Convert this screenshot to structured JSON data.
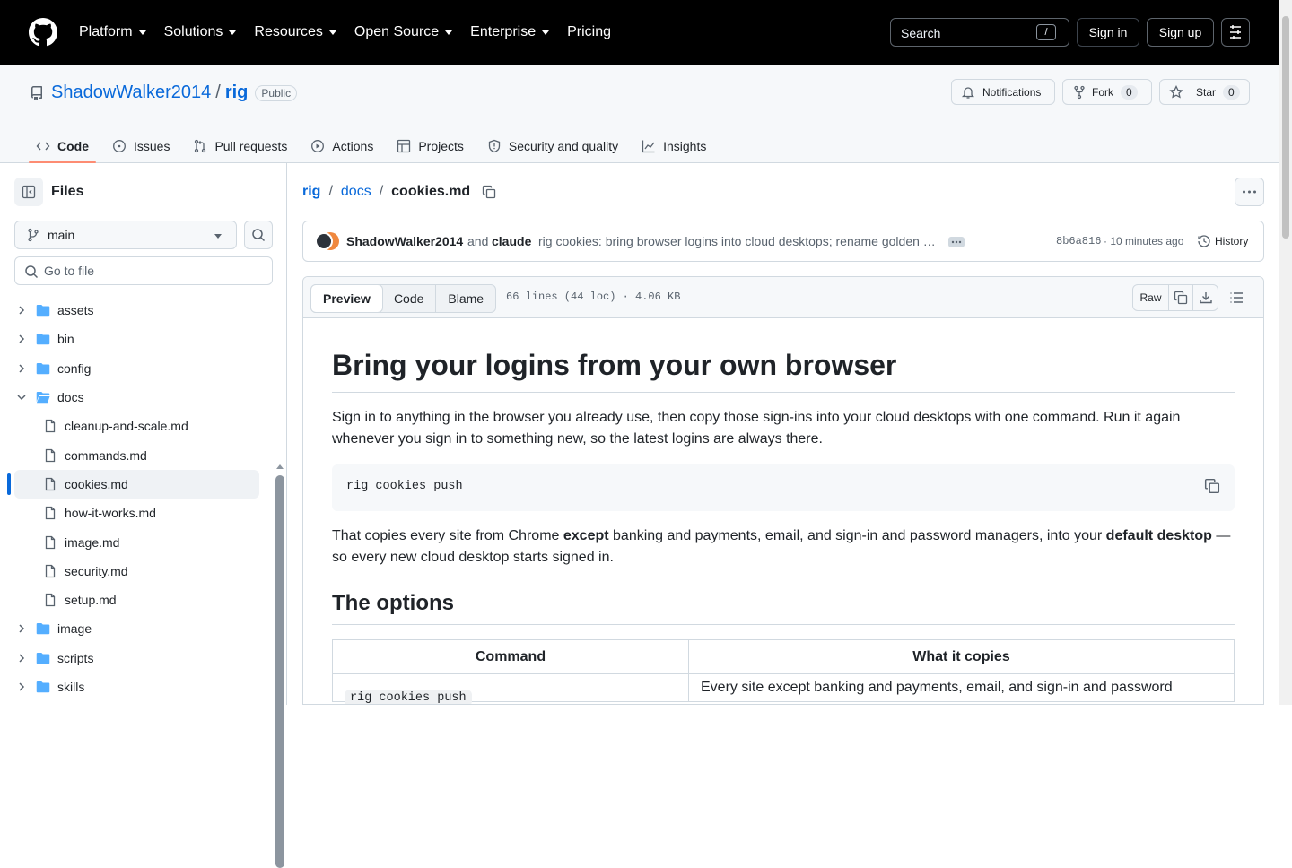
{
  "gnav": {
    "items": [
      "Platform",
      "Solutions",
      "Resources",
      "Open Source",
      "Enterprise"
    ],
    "pricing": "Pricing"
  },
  "header": {
    "search": "Search",
    "search_key": "/",
    "signin": "Sign in",
    "signup": "Sign up"
  },
  "repo": {
    "owner": "ShadowWalker2014",
    "sep": "/",
    "name": "rig",
    "visibility": "Public",
    "notifications": "Notifications",
    "fork": "Fork",
    "fork_count": "0",
    "star": "Star",
    "star_count": "0"
  },
  "tabs": [
    "Code",
    "Issues",
    "Pull requests",
    "Actions",
    "Projects",
    "Security and quality",
    "Insights"
  ],
  "sidebar": {
    "title": "Files",
    "branch": "main",
    "goto": "Go to file",
    "tree": [
      {
        "name": "assets",
        "type": "dir",
        "open": false
      },
      {
        "name": "bin",
        "type": "dir",
        "open": false
      },
      {
        "name": "config",
        "type": "dir",
        "open": false
      },
      {
        "name": "docs",
        "type": "dir",
        "open": true
      },
      {
        "name": "cleanup-and-scale.md",
        "type": "file"
      },
      {
        "name": "commands.md",
        "type": "file"
      },
      {
        "name": "cookies.md",
        "type": "file",
        "selected": true
      },
      {
        "name": "how-it-works.md",
        "type": "file"
      },
      {
        "name": "image.md",
        "type": "file"
      },
      {
        "name": "security.md",
        "type": "file"
      },
      {
        "name": "setup.md",
        "type": "file"
      },
      {
        "name": "image",
        "type": "dir",
        "open": false
      },
      {
        "name": "scripts",
        "type": "dir",
        "open": false
      },
      {
        "name": "skills",
        "type": "dir",
        "open": false
      }
    ]
  },
  "breadcrumb": {
    "root": "rig",
    "dir": "docs",
    "file": "cookies.md"
  },
  "commit": {
    "author": "ShadowWalker2014",
    "and": "and",
    "coauthor": "claude",
    "message": "rig cookies: bring browser logins into cloud desktops; rename golden …",
    "sha": "8b6a816",
    "time": "· 10 minutes ago",
    "history": "History"
  },
  "file": {
    "modes": [
      "Preview",
      "Code",
      "Blame"
    ],
    "meta": "66 lines (44 loc) · 4.06 KB",
    "raw": "Raw"
  },
  "doc": {
    "h1": "Bring your logins from your own browser",
    "p1": "Sign in to anything in the browser you already use, then copy those sign-ins into your cloud desktops with one command. Run it again whenever you sign in to something new, so the latest logins are always there.",
    "code1": "rig cookies push",
    "p2a": "That copies every site from Chrome ",
    "p2b": "except",
    "p2c": " banking and payments, email, and sign-in and password managers, into your ",
    "p2d": "default desktop",
    "p2e": " — so every new cloud desktop starts signed in.",
    "h2": "The options",
    "table": {
      "headers": [
        "Command",
        "What it copies"
      ],
      "rows": [
        [
          "rig cookies push",
          "Every site except banking and payments, email, and sign-in and password"
        ]
      ]
    }
  }
}
